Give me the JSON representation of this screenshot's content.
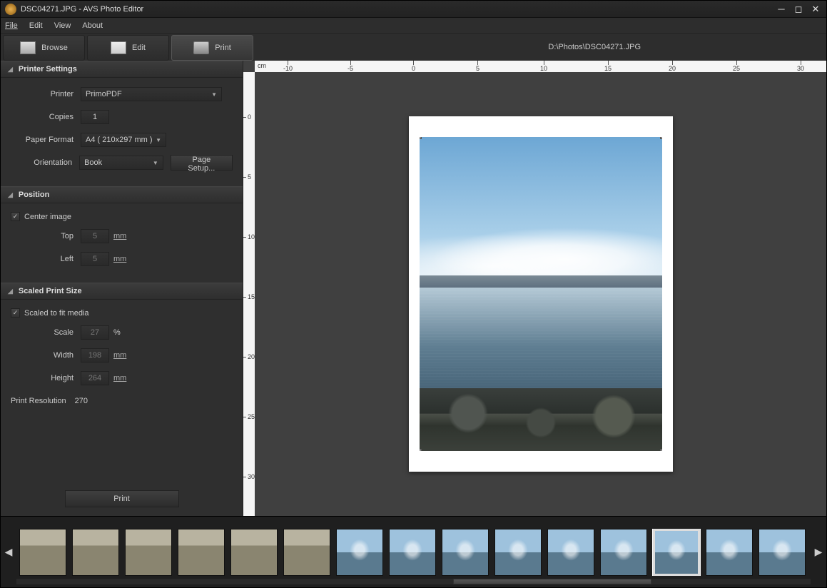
{
  "title": "DSC04271.JPG  -  AVS Photo Editor",
  "menu": {
    "file": "File",
    "edit": "Edit",
    "view": "View",
    "about": "About"
  },
  "tabs": {
    "browse": "Browse",
    "edit": "Edit",
    "print": "Print"
  },
  "filepath": "D:\\Photos\\DSC04271.JPG",
  "sections": {
    "printer_settings": {
      "title": "Printer Settings",
      "printer_label": "Printer",
      "printer_value": "PrimoPDF",
      "copies_label": "Copies",
      "copies_value": "1",
      "paper_label": "Paper Format",
      "paper_value": "A4 ( 210x297 mm )",
      "orientation_label": "Orientation",
      "orientation_value": "Book",
      "page_setup": "Page Setup..."
    },
    "position": {
      "title": "Position",
      "center_label": "Center image",
      "center_checked": true,
      "top_label": "Top",
      "top_value": "5",
      "left_label": "Left",
      "left_value": "5",
      "unit": "mm"
    },
    "scaled": {
      "title": "Scaled Print Size",
      "fit_label": "Scaled to fit media",
      "fit_checked": true,
      "scale_label": "Scale",
      "scale_value": "27",
      "scale_unit": "%",
      "width_label": "Width",
      "width_value": "198",
      "height_label": "Height",
      "height_value": "264",
      "unit": "mm",
      "res_label": "Print Resolution",
      "res_value": "270"
    }
  },
  "print_button": "Print",
  "ruler_h_unit": "cm",
  "ruler_h": [
    "-10",
    "-5",
    "0",
    "5",
    "10",
    "15",
    "20",
    "25",
    "30"
  ],
  "ruler_v": [
    "0",
    "5",
    "10",
    "15",
    "20",
    "25",
    "30"
  ],
  "thumbs_count": 15,
  "thumb_selected_index": 12
}
